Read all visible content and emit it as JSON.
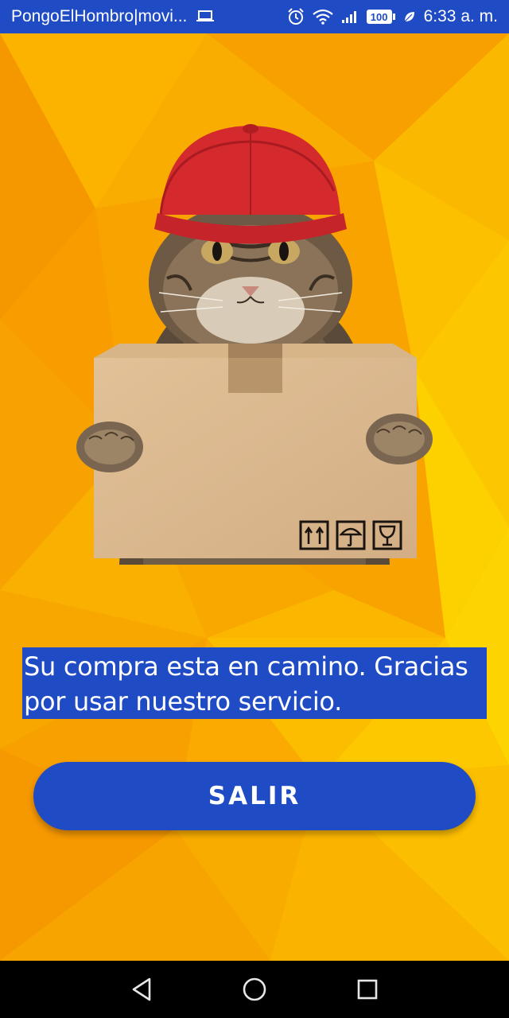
{
  "status_bar": {
    "notification_title": "PongoElHombro|movi...",
    "battery_level": "100",
    "time": "6:33 a. m.",
    "icons": [
      "laptop-icon",
      "alarm-icon",
      "wifi-icon",
      "signal-icon",
      "battery-icon",
      "leaf-icon"
    ]
  },
  "main": {
    "message": "Su compra esta en camino. Gracias por usar nuestro servicio.",
    "exit_button_label": "SALIR"
  },
  "nav_bar": {
    "buttons": [
      "back-icon",
      "home-icon",
      "recents-icon"
    ]
  },
  "colors": {
    "primary": "#1f4bc4",
    "background": "#f7a400",
    "nav": "#000000"
  }
}
